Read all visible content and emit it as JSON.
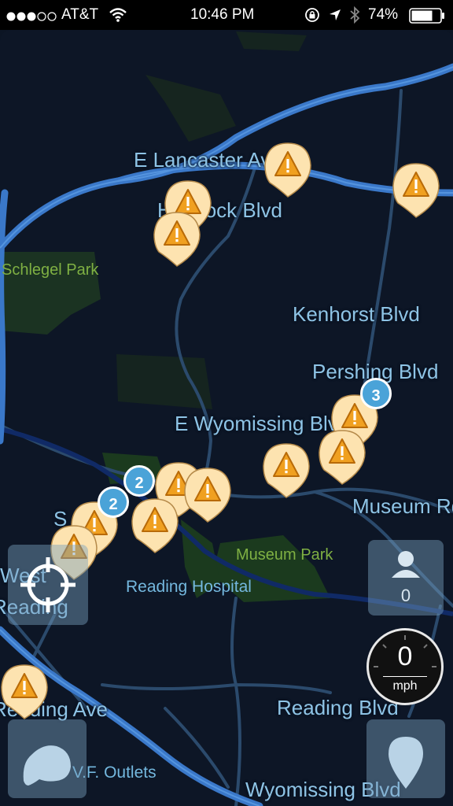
{
  "status_bar": {
    "carrier": "AT&T",
    "time": "10:46 PM",
    "battery_percent": "74%",
    "signal_bars_filled": 3,
    "signal_bars_total": 5,
    "battery_level": 0.74
  },
  "map": {
    "roads": {
      "lancaster": "E Lancaster Ave",
      "hancock": "Hancock Blvd",
      "kenhorst": "Kenhorst Blvd",
      "pershing": "Pershing Blvd",
      "wyomissing_e": "E Wyomissing Blvd",
      "museum": "Museum Rd",
      "west_reading_1": "West",
      "west_reading_2": "Reading",
      "reading_ave": "Reading Ave",
      "reading_blvd": "Reading Blvd",
      "wyomissing": "Wyomissing Blvd",
      "s_label": "S"
    },
    "places": {
      "schlegel_park": "Schlegel Park",
      "museum_park": "Museum Park",
      "reading_hospital": "Reading Hospital",
      "vf_outlets": "V.F. Outlets"
    },
    "clusters": [
      "3",
      "2",
      "2"
    ]
  },
  "controls": {
    "user_count": "0",
    "speed_value": "0",
    "speed_unit": "mph"
  },
  "colors": {
    "map_bg": "#0d1626",
    "highway": "#3a78c9",
    "street": "#2a4a6a",
    "park": "#1e3a20",
    "alert_pin": "#fde3b0",
    "alert_triangle": "#f0a020",
    "cluster": "#4aa3d8"
  }
}
